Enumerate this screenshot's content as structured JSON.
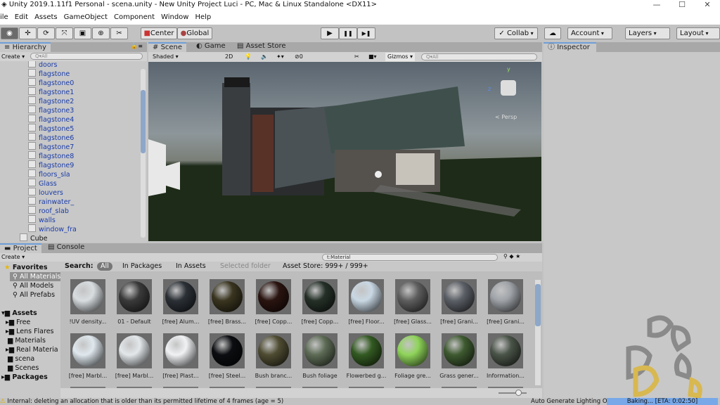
{
  "window": {
    "title": "Unity 2019.1.11f1 Personal - scena.unity - New Unity Project Luci - PC, Mac & Linux Standalone <DX11>",
    "controls": [
      "—",
      "☐",
      "✕"
    ]
  },
  "menu": [
    "ile",
    "Edit",
    "Assets",
    "GameObject",
    "Component",
    "Window",
    "Help"
  ],
  "toolbar": {
    "tools": [
      "◉",
      "✛",
      "⟳",
      "⤧",
      "▣",
      "⊕",
      "✂"
    ],
    "center": "Center",
    "global": "Global",
    "play": "▶",
    "pause": "❚❚",
    "step": "▶❚",
    "collab": "Collab",
    "account": "Account",
    "layers": "Layers",
    "layout": "Layout"
  },
  "hierarchy": {
    "tab": "Hierarchy",
    "create": "Create",
    "search_placeholder": "Q▾All",
    "items": [
      "doors",
      "flagstone",
      "flagstone0",
      "flagstone1",
      "flagstone2",
      "flagstone3",
      "flagstone4",
      "flagstone5",
      "flagstone6",
      "flagstone7",
      "flagstone8",
      "flagstone9",
      "floors_sla",
      "Glass",
      "louvers",
      "rainwater_",
      "roof_slab",
      "walls",
      "window_fra"
    ],
    "root_item": "Cube"
  },
  "scene": {
    "tabs": [
      "Scene",
      "Game",
      "Asset Store"
    ],
    "active_tab": "Scene",
    "shading": "Shaded",
    "mode_2d": "2D",
    "fx_count": "0",
    "gizmos": "Gizmos",
    "search_placeholder": "Q▾All",
    "persp": "< Persp",
    "axis_labels": {
      "y": "y",
      "z": "z"
    }
  },
  "inspector": {
    "tab": "Inspector"
  },
  "project": {
    "tabs": [
      "Project",
      "Console"
    ],
    "create": "Create",
    "search_value": "t:Material",
    "search_scopes": {
      "label": "Search:",
      "all": "All",
      "packages": "In Packages",
      "assets": "In Assets",
      "selected": "Selected folder",
      "store": "Asset Store: 999+ / 999+"
    },
    "favorites": {
      "label": "Favorites",
      "items": [
        "All Materials",
        "All Models",
        "All Prefabs"
      ]
    },
    "assets": {
      "label": "Assets",
      "items": [
        "Free",
        "Lens Flares",
        "Materials",
        "Real Materia",
        "scena",
        "Scenes"
      ]
    },
    "packages": "Packages",
    "materials": [
      {
        "name": "!UV density...",
        "color": "#d8dde0"
      },
      {
        "name": "01 - Default",
        "color": "#3a3a3a"
      },
      {
        "name": "[free] Alum...",
        "color": "#2b3036"
      },
      {
        "name": "[free] Brass...",
        "color": "#3a3520"
      },
      {
        "name": "[free] Copp...",
        "color": "#2a1410"
      },
      {
        "name": "[free] Copp...",
        "color": "#253028"
      },
      {
        "name": "[free] Floor...",
        "color": "#c9d8e4"
      },
      {
        "name": "[free] Glass...",
        "color": "#5e5e5e"
      },
      {
        "name": "[free] Grani...",
        "color": "#5b5f66"
      },
      {
        "name": "[free] Grani...",
        "color": "#9fa3a8"
      },
      {
        "name": "[free] Marbl...",
        "color": "#dfe8ee"
      },
      {
        "name": "[free] Marbl...",
        "color": "#e3e7ea"
      },
      {
        "name": "[free] Plast...",
        "color": "#f0f2f4"
      },
      {
        "name": "[free] Steel...",
        "color": "#0b0d10"
      },
      {
        "name": "Bush branc...",
        "color": "#4f4c32"
      },
      {
        "name": "Bush foliage",
        "color": "#5d6b55"
      },
      {
        "name": "Flowerbed g...",
        "color": "#335a22"
      },
      {
        "name": "Foliage gre...",
        "color": "#8fd45a"
      },
      {
        "name": "Grass gener...",
        "color": "#3e5a30"
      },
      {
        "name": "Information...",
        "color": "#4a5448"
      }
    ]
  },
  "status": {
    "message": "Internal: deleting an allocation that is older than its permitted lifetime of 4 frames (age = 5)",
    "lighting": "Auto Generate Lighting On",
    "baking": "Baking... [ETA: 0:02:50]"
  },
  "colors": {
    "accent": "#6f9ed8",
    "baking_bar": "#78a8e8",
    "hier_text": "#1a3ca8"
  }
}
